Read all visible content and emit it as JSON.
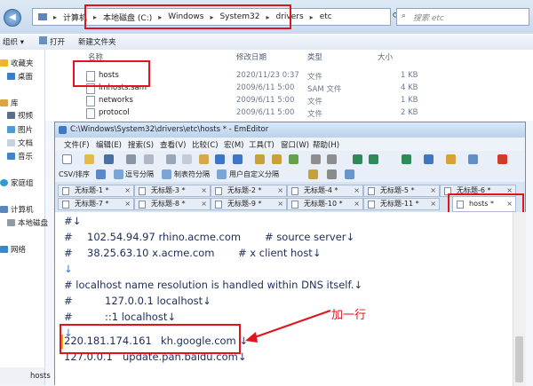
{
  "explorer": {
    "address": {
      "crumbs": [
        "计算机",
        "本地磁盘 (C:)",
        "Windows",
        "System32",
        "drivers",
        "etc"
      ]
    },
    "search_placeholder": "搜索 etc",
    "commands": {
      "organize": "组织 ▾",
      "open": "打开",
      "new_folder": "新建文件夹"
    },
    "nav": [
      {
        "label": "收藏夹"
      },
      {
        "label": "桌面"
      },
      {
        "label": "库"
      },
      {
        "label": "视频"
      },
      {
        "label": "图片"
      },
      {
        "label": "文档"
      },
      {
        "label": "音乐"
      },
      {
        "label": "家庭组"
      },
      {
        "label": "计算机"
      },
      {
        "label": "本地磁盘"
      },
      {
        "label": "网络"
      }
    ],
    "columns": {
      "name": "名称",
      "modified": "修改日期",
      "type": "类型",
      "size": "大小"
    },
    "files": [
      {
        "name": "hosts",
        "modified": "2020/11/23 0:37",
        "type": "文件",
        "size": "1 KB"
      },
      {
        "name": "lmhosts.sam",
        "modified": "2009/6/11 5:00",
        "type": "SAM 文件",
        "size": "4 KB"
      },
      {
        "name": "networks",
        "modified": "2009/6/11 5:00",
        "type": "文件",
        "size": "1 KB"
      },
      {
        "name": "protocol",
        "modified": "2009/6/11 5:00",
        "type": "文件",
        "size": "2 KB"
      }
    ],
    "status_item": "hosts"
  },
  "editor": {
    "title": "C:\\Windows\\System32\\drivers\\etc\\hosts * - EmEditor",
    "menu": [
      "文件(F)",
      "编辑(E)",
      "搜索(S)",
      "查看(V)",
      "比较(C)",
      "宏(M)",
      "工具(T)",
      "窗口(W)",
      "帮助(H)"
    ],
    "toolbar2": {
      "csv": "CSV/排序",
      "comma": "逗号分隔",
      "tab": "制表符分隔",
      "custom": "用户自定义分隔"
    },
    "tabs_row1": [
      "无标题-1 *",
      "无标题-3 *",
      "无标题-2 *",
      "无标题-4 *",
      "无标题-5 *",
      "无标题-6 *"
    ],
    "tabs_row2": [
      "无标题-7 *",
      "无标题-8 *",
      "无标题-9 *",
      "无标题-10 *",
      "无标题-11 *",
      "hosts *"
    ],
    "lines": [
      {
        "a": "#↓",
        "b": "",
        "c": ""
      },
      {
        "a": "#",
        "b": "102.54.94.97     rhino.acme.com",
        "c": "# source server↓"
      },
      {
        "a": "#",
        "b": "38.25.63.10     x.acme.com",
        "c": "# x client host↓"
      },
      {
        "a": "↓",
        "b": "",
        "c": ""
      },
      {
        "a": "# localhost name resolution is handled within DNS itself.↓",
        "b": "",
        "c": ""
      },
      {
        "a": "#",
        "b": "127.0.0.1       localhost↓",
        "c": ""
      },
      {
        "a": "#",
        "b": "::1            localhost↓",
        "c": ""
      },
      {
        "a": "↓",
        "b": "",
        "c": ""
      },
      {
        "a": "220.181.174.161",
        "b": "kh.google.com  ↓",
        "c": ""
      },
      {
        "a": "127.0.0.1",
        "b": "update.pan.baidu.com↓",
        "c": ""
      }
    ]
  },
  "annotation": {
    "label": "加一行",
    "color": "#e0141b"
  }
}
